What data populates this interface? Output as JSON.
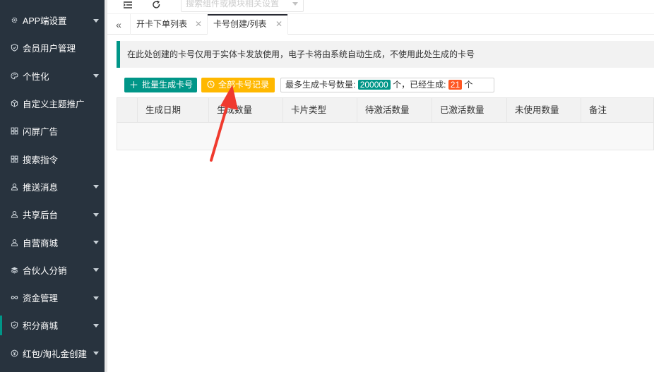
{
  "sidebar": {
    "items": [
      {
        "label": "APP端设置",
        "icon": "gear-icon",
        "arrow": true
      },
      {
        "label": "会员用户管理",
        "icon": "shield-icon",
        "arrow": false
      },
      {
        "label": "个性化",
        "icon": "palette-icon",
        "arrow": true
      },
      {
        "label": "自定义主题推广",
        "icon": "cube-icon",
        "arrow": false
      },
      {
        "label": "闪屏广告",
        "icon": "grid-icon",
        "arrow": false
      },
      {
        "label": "搜索指令",
        "icon": "grid-icon",
        "arrow": false
      },
      {
        "label": "推送消息",
        "icon": "user-icon",
        "arrow": true
      },
      {
        "label": "共享后台",
        "icon": "user-icon",
        "arrow": true
      },
      {
        "label": "自营商城",
        "icon": "user-icon",
        "arrow": true
      },
      {
        "label": "合伙人分销",
        "icon": "layers-icon",
        "arrow": true
      },
      {
        "label": "资金管理",
        "icon": "infinity-icon",
        "arrow": true
      },
      {
        "label": "积分商城",
        "icon": "shield-icon",
        "arrow": true
      },
      {
        "label": "红包/淘礼金创建",
        "icon": "yen-icon",
        "arrow": true
      }
    ]
  },
  "topbar": {
    "search_placeholder": "搜索组件或模块相关设置"
  },
  "tabs": [
    {
      "label": "开卡下单列表"
    },
    {
      "label": "卡号创建/列表"
    }
  ],
  "notice": "在此处创建的卡号仅用于实体卡发放使用，电子卡将由系统自动生成，不使用此处生成的卡号",
  "toolbar": {
    "batch_label": "批量生成卡号",
    "all_label": "全部卡号记录",
    "stat_prefix": "最多生成卡号数量:",
    "max_count": "200000",
    "stat_mid": "个，已经生成:",
    "generated": "21",
    "stat_suffix": "个"
  },
  "table": {
    "columns": [
      "生成日期",
      "生成数量",
      "卡片类型",
      "待激活数量",
      "已激活数量",
      "未使用数量",
      "备注"
    ]
  },
  "colors": {
    "sidebar_bg": "#28333e",
    "accent_teal": "#009688",
    "accent_orange": "#ffb800",
    "badge_red": "#ff5722",
    "annotation_red": "#f03a2e"
  }
}
